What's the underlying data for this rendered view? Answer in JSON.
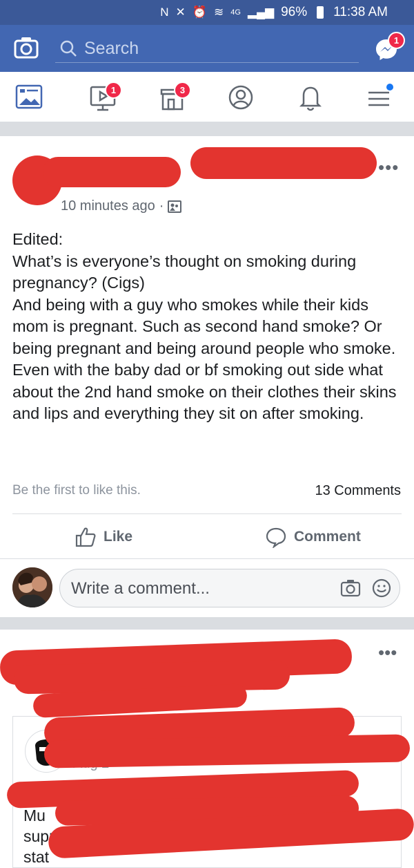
{
  "status_bar": {
    "battery": "96%",
    "time": "11:38 AM",
    "network": "4G"
  },
  "header": {
    "search_placeholder": "Search",
    "messenger_badge": "1",
    "brand_color": "#4267b2"
  },
  "nav": {
    "items": [
      {
        "icon": "news-feed-icon",
        "badge": ""
      },
      {
        "icon": "watch-video-icon",
        "badge": "1"
      },
      {
        "icon": "marketplace-icon",
        "badge": "3"
      },
      {
        "icon": "profile-icon",
        "badge": ""
      },
      {
        "icon": "notifications-bell-icon",
        "badge": ""
      },
      {
        "icon": "menu-icon",
        "badge": ""
      }
    ]
  },
  "post": {
    "time": "10 minutes ago",
    "privacy_separator": "·",
    "text": "Edited:\nWhat’s is everyone’s thought on smoking during pregnancy? (Cigs)\nAnd being with a guy who smokes while their kids mom is pregnant. Such as second hand smoke? Or being pregnant and being around people who smoke.\nEven with the baby dad or bf smoking out side what about the 2nd hand smoke on their clothes their skins and lips and everything they sit on after smoking.",
    "likes_text": "Be the first to like this.",
    "comments_count": "13 Comments",
    "like_label": "Like",
    "comment_label": "Comment",
    "comment_placeholder": "Write a comment..."
  },
  "post2": {
    "meta": "Aug 2",
    "text_fragments": "Mu\nsupp\nstat"
  },
  "colors": {
    "redaction": "#e3342f",
    "badge": "#f02849"
  }
}
